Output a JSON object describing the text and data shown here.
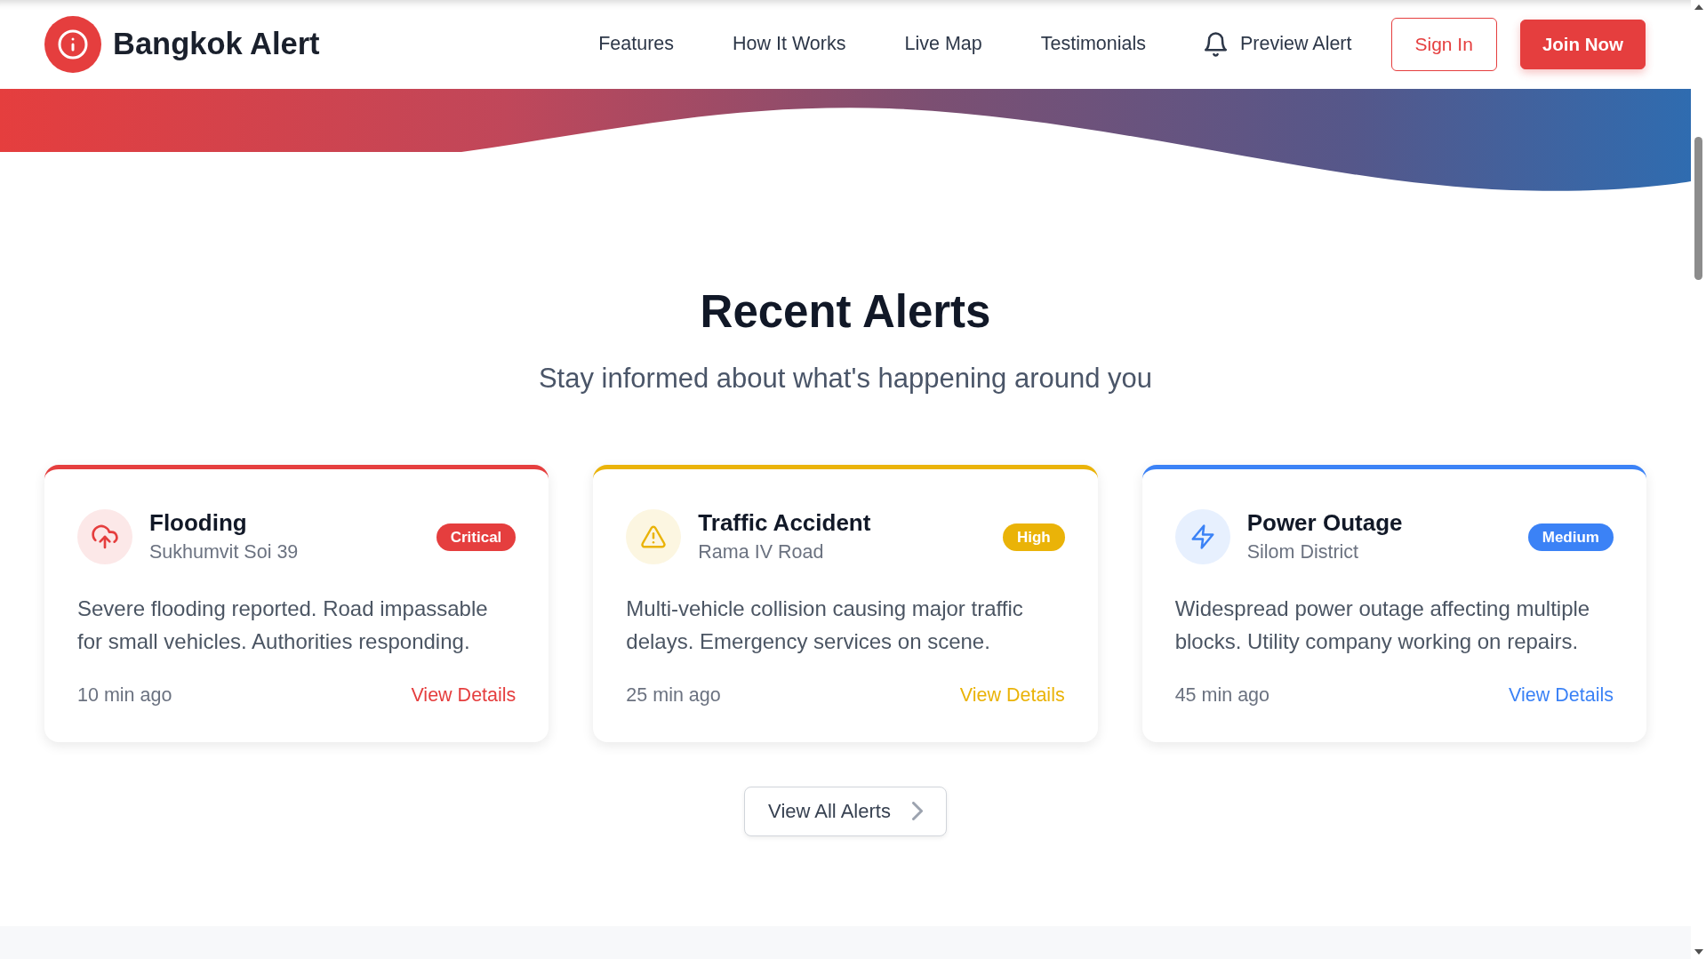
{
  "navbar": {
    "brand": "Bangkok Alert",
    "links": [
      "Features",
      "How It Works",
      "Live Map",
      "Testimonials"
    ],
    "preview_alert": "Preview Alert",
    "sign_in": "Sign In",
    "join": "Join Now"
  },
  "recent_alerts": {
    "title": "Recent Alerts",
    "subtitle": "Stay informed about what's happening around you",
    "alerts": [
      {
        "kind": "flood",
        "title": "Flooding",
        "location": "Sukhumvit Soi 39",
        "severity": "Critical",
        "color": "#e53e3e",
        "description": "Severe flooding reported. Road impassable for small vehicles. Authorities responding.",
        "time": "10 min ago",
        "link": "View Details"
      },
      {
        "kind": "traffic",
        "title": "Traffic Accident",
        "location": "Rama IV Road",
        "severity": "High",
        "color": "#eab308",
        "description": "Multi-vehicle collision causing major traffic delays. Emergency services on scene.",
        "time": "25 min ago",
        "link": "View Details"
      },
      {
        "kind": "power",
        "title": "Power Outage",
        "location": "Silom District",
        "severity": "Medium",
        "color": "#3b82f6",
        "description": "Widespread power outage affecting multiple blocks. Utility company working on repairs.",
        "time": "45 min ago",
        "link": "View Details"
      }
    ],
    "view_all": "View All Alerts"
  }
}
